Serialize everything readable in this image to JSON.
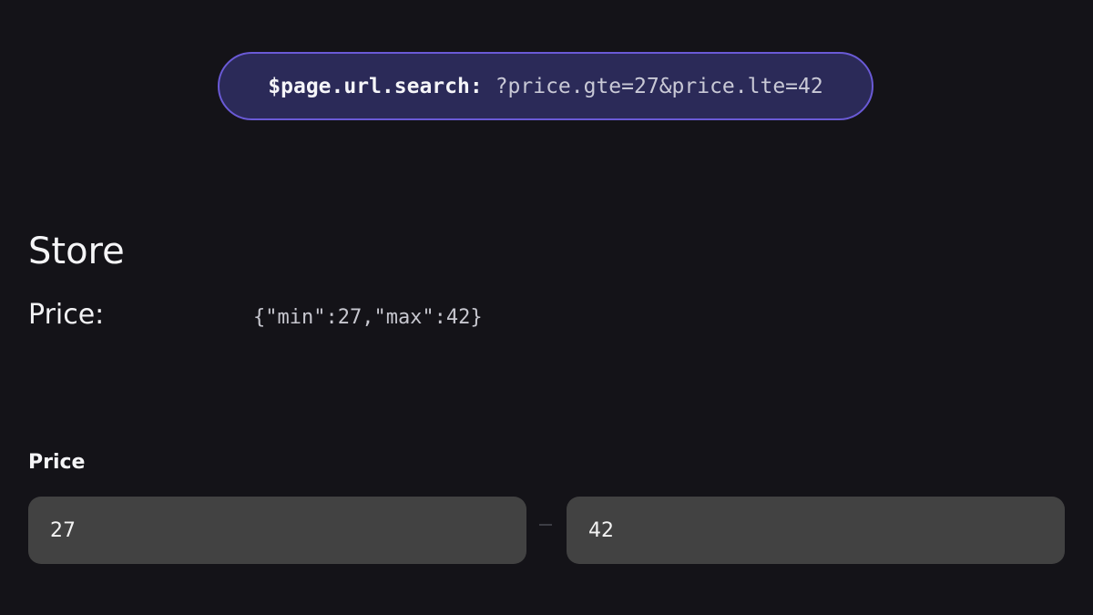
{
  "url_bar": {
    "key": "$page.url.search:",
    "value": "?price.gte=27&price.lte=42"
  },
  "store": {
    "title": "Store",
    "price_label": "Price:",
    "price_value": "{\"min\":27,\"max\":42}"
  },
  "filter": {
    "label": "Price",
    "min_value": "27",
    "max_value": "42"
  }
}
